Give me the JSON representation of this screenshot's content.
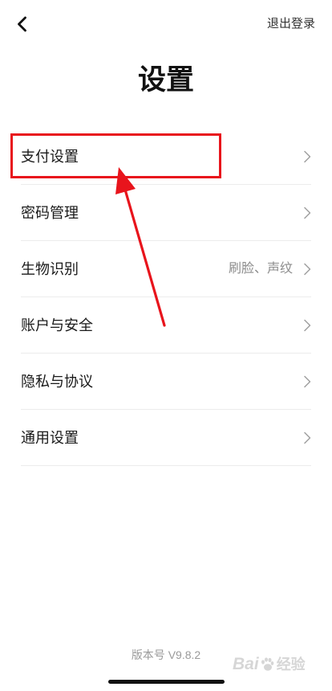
{
  "colors": {
    "background": "#ffffff",
    "text_primary": "#1a1a1a",
    "text_secondary": "#8c8c8c",
    "chevron": "#a0a0a0",
    "divider": "#ececec",
    "annotation_red": "#e8141c",
    "home_indicator": "#111111"
  },
  "header": {
    "back_icon": "chevron-left-icon",
    "logout_label": "退出登录"
  },
  "page_title": "设置",
  "settings": {
    "items": [
      {
        "label": "支付设置",
        "trailing_icon": "chevron-right-icon"
      },
      {
        "label": "密码管理",
        "trailing_icon": "chevron-right-icon"
      },
      {
        "label": "生物识别",
        "value": "刷脸、声纹",
        "trailing_icon": "chevron-right-icon"
      },
      {
        "label": "账户与安全",
        "trailing_icon": "chevron-right-icon"
      },
      {
        "label": "隐私与协议",
        "trailing_icon": "chevron-right-icon"
      },
      {
        "label": "通用设置",
        "trailing_icon": "chevron-right-icon"
      }
    ]
  },
  "annotation": {
    "highlight_index": 0,
    "arrow_icon": "red-arrow-icon"
  },
  "footer": {
    "version_text": "版本号 V9.8.2"
  },
  "watermark": {
    "logo_latin": "Bai",
    "logo_cn": "经验",
    "paw_icon": "paw-icon"
  }
}
